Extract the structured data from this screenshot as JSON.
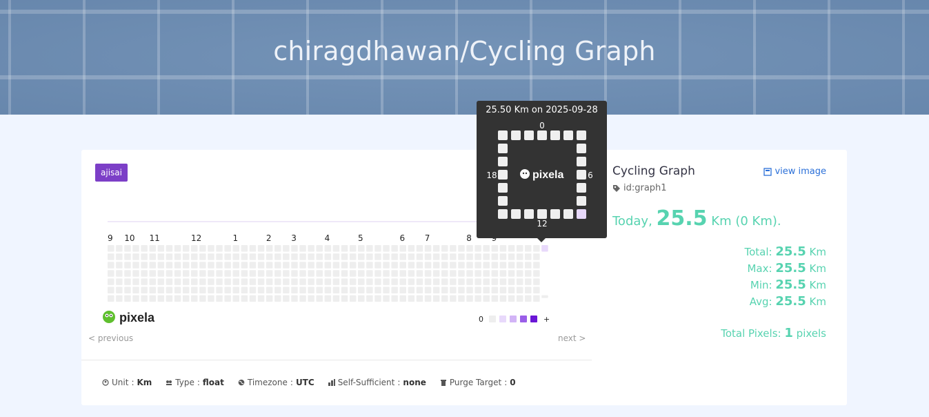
{
  "header": {
    "title": "chiragdhawan/Cycling Graph"
  },
  "graph": {
    "theme": "ajisai",
    "month_labels": [
      "9",
      "10",
      "11",
      "12",
      "1",
      "2",
      "3",
      "4",
      "5",
      "6",
      "7",
      "8",
      "9"
    ],
    "legend_low": "0",
    "legend_high": "+",
    "logo_text": "pixela",
    "prev_label": "< previous",
    "next_label": "next >",
    "colors": {
      "empty": "#eeeeee",
      "level1": "#e8d9fb",
      "level2": "#d2b4f6",
      "level3": "#b78cf0",
      "level4": "#9a5ee8",
      "level5": "#6a16d6"
    }
  },
  "footer": {
    "unit_label": "Unit",
    "unit_value": "Km",
    "type_label": "Type",
    "type_value": "float",
    "timezone_label": "Timezone",
    "timezone_value": "UTC",
    "self_sufficient_label": "Self-Sufficient",
    "self_sufficient_value": "none",
    "purge_label": "Purge Target",
    "purge_value": "0",
    "separator": ":"
  },
  "info": {
    "name": "Cycling Graph",
    "id": "id:graph1",
    "view_image": "view image",
    "today_label": "Today",
    "today_comma": ",",
    "today_value": "25.5",
    "today_unit": "Km (0 Km).",
    "total_label": "Total:",
    "total_value": "25.5",
    "max_label": "Max:",
    "max_value": "25.5",
    "min_label": "Min:",
    "min_value": "25.5",
    "avg_label": "Avg:",
    "avg_value": "25.5",
    "unit": "Km",
    "total_pixels_label": "Total Pixels:",
    "total_pixels_value": "1",
    "pixels_word": "pixels"
  },
  "tooltip": {
    "title": "25.50 Km on 2025-09-28",
    "top": "0",
    "right": "6",
    "bottom": "12",
    "left": "18",
    "logo_text": "pixela"
  }
}
